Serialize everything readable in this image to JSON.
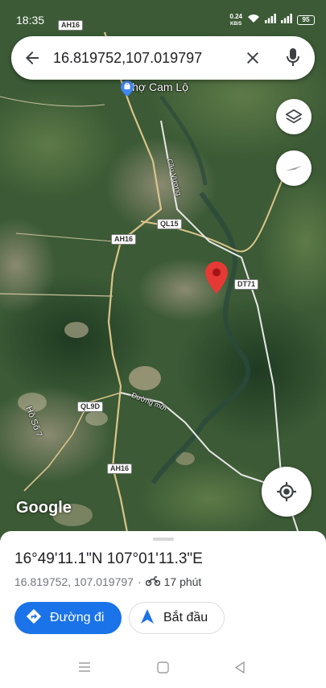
{
  "status_bar": {
    "time": "18:35",
    "speed_value": "0.24",
    "speed_unit": "KB/S",
    "battery": "95"
  },
  "search": {
    "query": "16.819752,107.019797"
  },
  "map": {
    "place_label": "Chợ Cam Lộ",
    "street_label": "Cầu Vương",
    "road_ah16_top": "AH16",
    "road_ah16_mid": "AH16",
    "road_ah16_bottom": "AH16",
    "road_ql15": "QL15",
    "road_dt71": "DT71",
    "road_ql9d": "QL9D",
    "new_road_label": "Đường mới",
    "lake_label": "Hồ Số 7",
    "google_logo": "Google"
  },
  "bottom_sheet": {
    "coords_dms": "16°49'11.1\"N 107°01'11.3\"E",
    "coords_decimal": "16.819752, 107.019797",
    "separator": "·",
    "travel_time": "17 phút",
    "directions_label": "Đường đi",
    "start_label": "Bắt đầu"
  },
  "colors": {
    "accent": "#1a73e8",
    "pin": "#e53935"
  }
}
